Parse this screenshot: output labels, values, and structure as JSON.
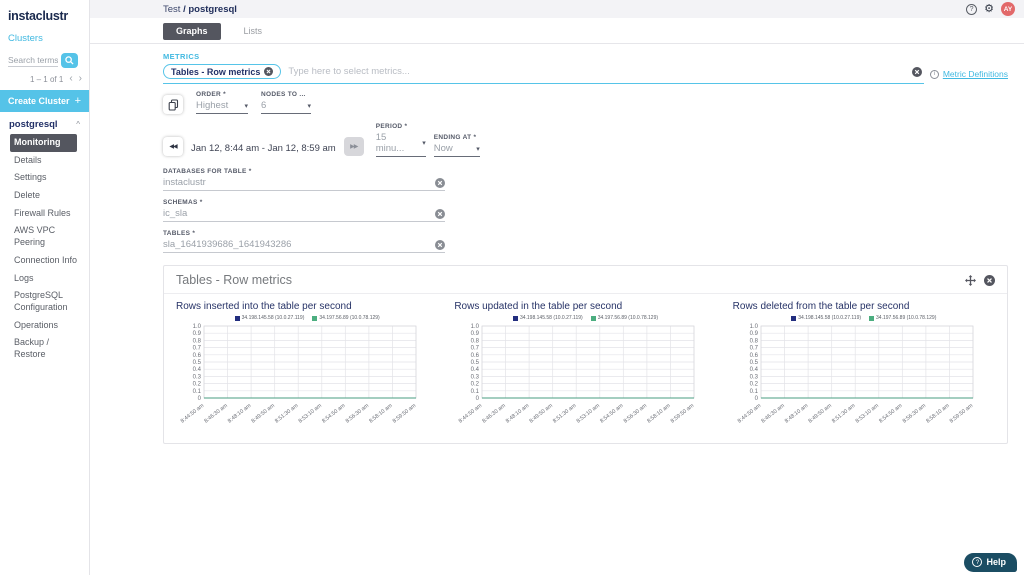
{
  "colors": {
    "accent": "#55c3e8",
    "navy": "#233168",
    "dark": "#54565f",
    "legend_navy": "#232e7f",
    "legend_green": "#4cae80",
    "avatar_bg": "#e2696a",
    "help_bg": "#1b4d63"
  },
  "icons": {
    "gear": "⚙",
    "question": "?",
    "info": "i",
    "plus": "+",
    "caret": "▾",
    "back": "◀◀",
    "forward": "▶▶",
    "collapse": "^",
    "prev": "‹",
    "next": "›"
  },
  "sidebar": {
    "logo": "instaclustr",
    "clusters_label": "Clusters",
    "search_placeholder": "Search terms",
    "pagination": "1 – 1 of 1",
    "create_cluster_label": "Create Cluster",
    "cluster_name": "postgresql",
    "items": [
      {
        "label": "Monitoring",
        "active": true
      },
      {
        "label": "Details",
        "active": false
      },
      {
        "label": "Settings",
        "active": false
      },
      {
        "label": "Delete",
        "active": false
      },
      {
        "label": "Firewall Rules",
        "active": false
      },
      {
        "label": "AWS VPC Peering",
        "active": false
      },
      {
        "label": "Connection Info",
        "active": false
      },
      {
        "label": "Logs",
        "active": false
      },
      {
        "label": "PostgreSQL Configuration",
        "active": false
      },
      {
        "label": "Operations",
        "active": false
      },
      {
        "label": "Backup / Restore",
        "active": false
      }
    ]
  },
  "header": {
    "breadcrumb_prefix": "Test",
    "breadcrumb_current": "/ postgresql",
    "avatar_initials": "AY"
  },
  "tabs": {
    "items": [
      {
        "label": "Graphs",
        "active": true
      },
      {
        "label": "Lists",
        "active": false
      }
    ]
  },
  "metrics": {
    "section_label": "METRICS",
    "chip_label": "Tables - Row metrics",
    "input_placeholder": "Type here to select metrics...",
    "definitions_link": "Metric Definitions"
  },
  "controls": {
    "order_label": "ORDER *",
    "order_value": "Highest",
    "nodes_label": "NODES TO ...",
    "nodes_value": "6",
    "date_range": "Jan 12, 8:44 am - Jan 12, 8:59 am",
    "period_label": "PERIOD *",
    "period_value": "15 minu...",
    "ending_label": "ENDING AT *",
    "ending_value": "Now"
  },
  "fields": {
    "items": [
      {
        "label": "DATABASES FOR TABLE *",
        "value": "instaclustr"
      },
      {
        "label": "SCHEMAS *",
        "value": "ic_sla"
      },
      {
        "label": "TABLES *",
        "value": "sla_1641939686_1641943286"
      }
    ]
  },
  "panel": {
    "title": "Tables - Row metrics"
  },
  "help": {
    "label": "Help"
  },
  "chart_data": [
    {
      "type": "line",
      "title": "Rows inserted into the table per second",
      "x": [
        "8:44:50 am",
        "8:46:30 am",
        "8:48:10 am",
        "8:49:50 am",
        "8:51:30 am",
        "8:53:10 am",
        "8:54:50 am",
        "8:56:30 am",
        "8:58:10 am",
        "8:59:50 am"
      ],
      "ylim": [
        0,
        1.0
      ],
      "yticks": [
        0,
        0.1,
        0.2,
        0.3,
        0.4,
        0.5,
        0.6,
        0.7,
        0.8,
        0.9,
        1.0
      ],
      "grid": true,
      "legend_position": "top",
      "series": [
        {
          "name": "34.198.145.58 (10.0.27.119)",
          "color": "#232e7f",
          "values": [
            0,
            0,
            0,
            0,
            0,
            0,
            0,
            0,
            0,
            0
          ]
        },
        {
          "name": "34.197.56.89 (10.0.78.129)",
          "color": "#4cae80",
          "values": [
            0,
            0,
            0,
            0,
            0,
            0,
            0,
            0,
            0,
            0
          ]
        }
      ]
    },
    {
      "type": "line",
      "title": "Rows updated in the table per second",
      "x": [
        "8:44:50 am",
        "8:46:30 am",
        "8:48:10 am",
        "8:49:50 am",
        "8:51:30 am",
        "8:53:10 am",
        "8:54:50 am",
        "8:56:30 am",
        "8:58:10 am",
        "8:59:50 am"
      ],
      "ylim": [
        0,
        1.0
      ],
      "yticks": [
        0,
        0.1,
        0.2,
        0.3,
        0.4,
        0.5,
        0.6,
        0.7,
        0.8,
        0.9,
        1.0
      ],
      "grid": true,
      "legend_position": "top",
      "series": [
        {
          "name": "34.198.145.58 (10.0.27.119)",
          "color": "#232e7f",
          "values": [
            0,
            0,
            0,
            0,
            0,
            0,
            0,
            0,
            0,
            0
          ]
        },
        {
          "name": "34.197.56.89 (10.0.78.129)",
          "color": "#4cae80",
          "values": [
            0,
            0,
            0,
            0,
            0,
            0,
            0,
            0,
            0,
            0
          ]
        }
      ]
    },
    {
      "type": "line",
      "title": "Rows deleted from the table per second",
      "x": [
        "8:44:50 am",
        "8:46:30 am",
        "8:48:10 am",
        "8:49:50 am",
        "8:51:30 am",
        "8:53:10 am",
        "8:54:50 am",
        "8:56:30 am",
        "8:58:10 am",
        "8:59:50 am"
      ],
      "ylim": [
        0,
        1.0
      ],
      "yticks": [
        0,
        0.1,
        0.2,
        0.3,
        0.4,
        0.5,
        0.6,
        0.7,
        0.8,
        0.9,
        1.0
      ],
      "grid": true,
      "legend_position": "top",
      "series": [
        {
          "name": "34.198.145.58 (10.0.27.119)",
          "color": "#232e7f",
          "values": [
            0,
            0,
            0,
            0,
            0,
            0,
            0,
            0,
            0,
            0
          ]
        },
        {
          "name": "34.197.56.89 (10.0.78.129)",
          "color": "#4cae80",
          "values": [
            0,
            0,
            0,
            0,
            0,
            0,
            0,
            0,
            0,
            0
          ]
        }
      ]
    }
  ]
}
